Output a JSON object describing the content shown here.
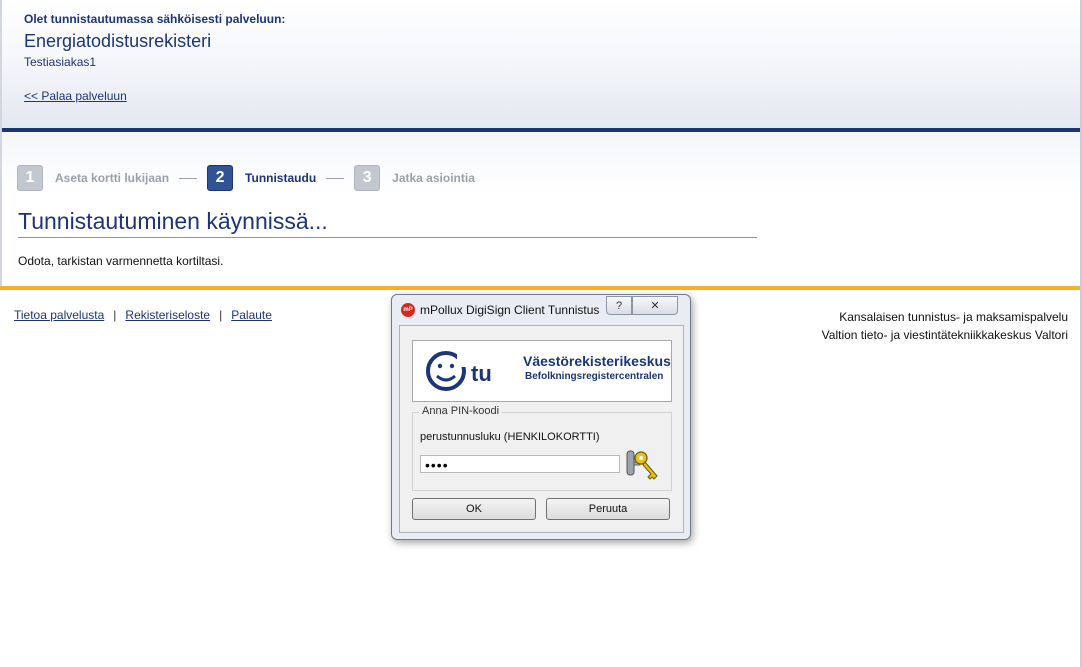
{
  "header": {
    "intro": "Olet tunnistautumassa sähköisesti palveluun:",
    "service_name": "Energiatodistusrekisteri",
    "customer": "Testiasiakas1",
    "back_link": "<< Palaa palveluun"
  },
  "steps": [
    {
      "number": "1",
      "label": "Aseta kortti lukijaan",
      "state": "inactive"
    },
    {
      "number": "2",
      "label": "Tunnistaudu",
      "state": "active"
    },
    {
      "number": "3",
      "label": "Jatka asiointia",
      "state": "inactive"
    }
  ],
  "main": {
    "title": "Tunnistautuminen käynnissä...",
    "message": "Odota, tarkistan varmennetta kortiltasi."
  },
  "footer": {
    "links": [
      "Tietoa palvelusta",
      "Rekisteriseloste",
      "Palaute"
    ],
    "separator": "|",
    "right_lines": [
      "Kansalaisen tunnistus- ja maksamispalvelu",
      "Valtion tieto- ja viestintätekniikkakeskus Valtori"
    ]
  },
  "dialog": {
    "title": "mPollux DigiSign Client Tunnistus",
    "help_label": "?",
    "close_label": "✕",
    "logo_mark": "tu",
    "logo_name": "Väestörekisterikeskus",
    "logo_subname": "Befolkningsregistercentralen",
    "group_label": "Anna PIN-koodi",
    "pin_description": "perustunnusluku (HENKILOKORTTI)",
    "pin_value": "••••",
    "ok_label": "OK",
    "cancel_label": "Peruuta",
    "icons": {
      "app": "mpollux-app-icon",
      "keys": "keys-icon",
      "logo": "vrk-logo-icon"
    }
  },
  "colors": {
    "brand_blue": "#1d3577",
    "accent_orange": "#f2b12c",
    "step_active": "#2f5394",
    "step_inactive": "#c3c7cf"
  }
}
